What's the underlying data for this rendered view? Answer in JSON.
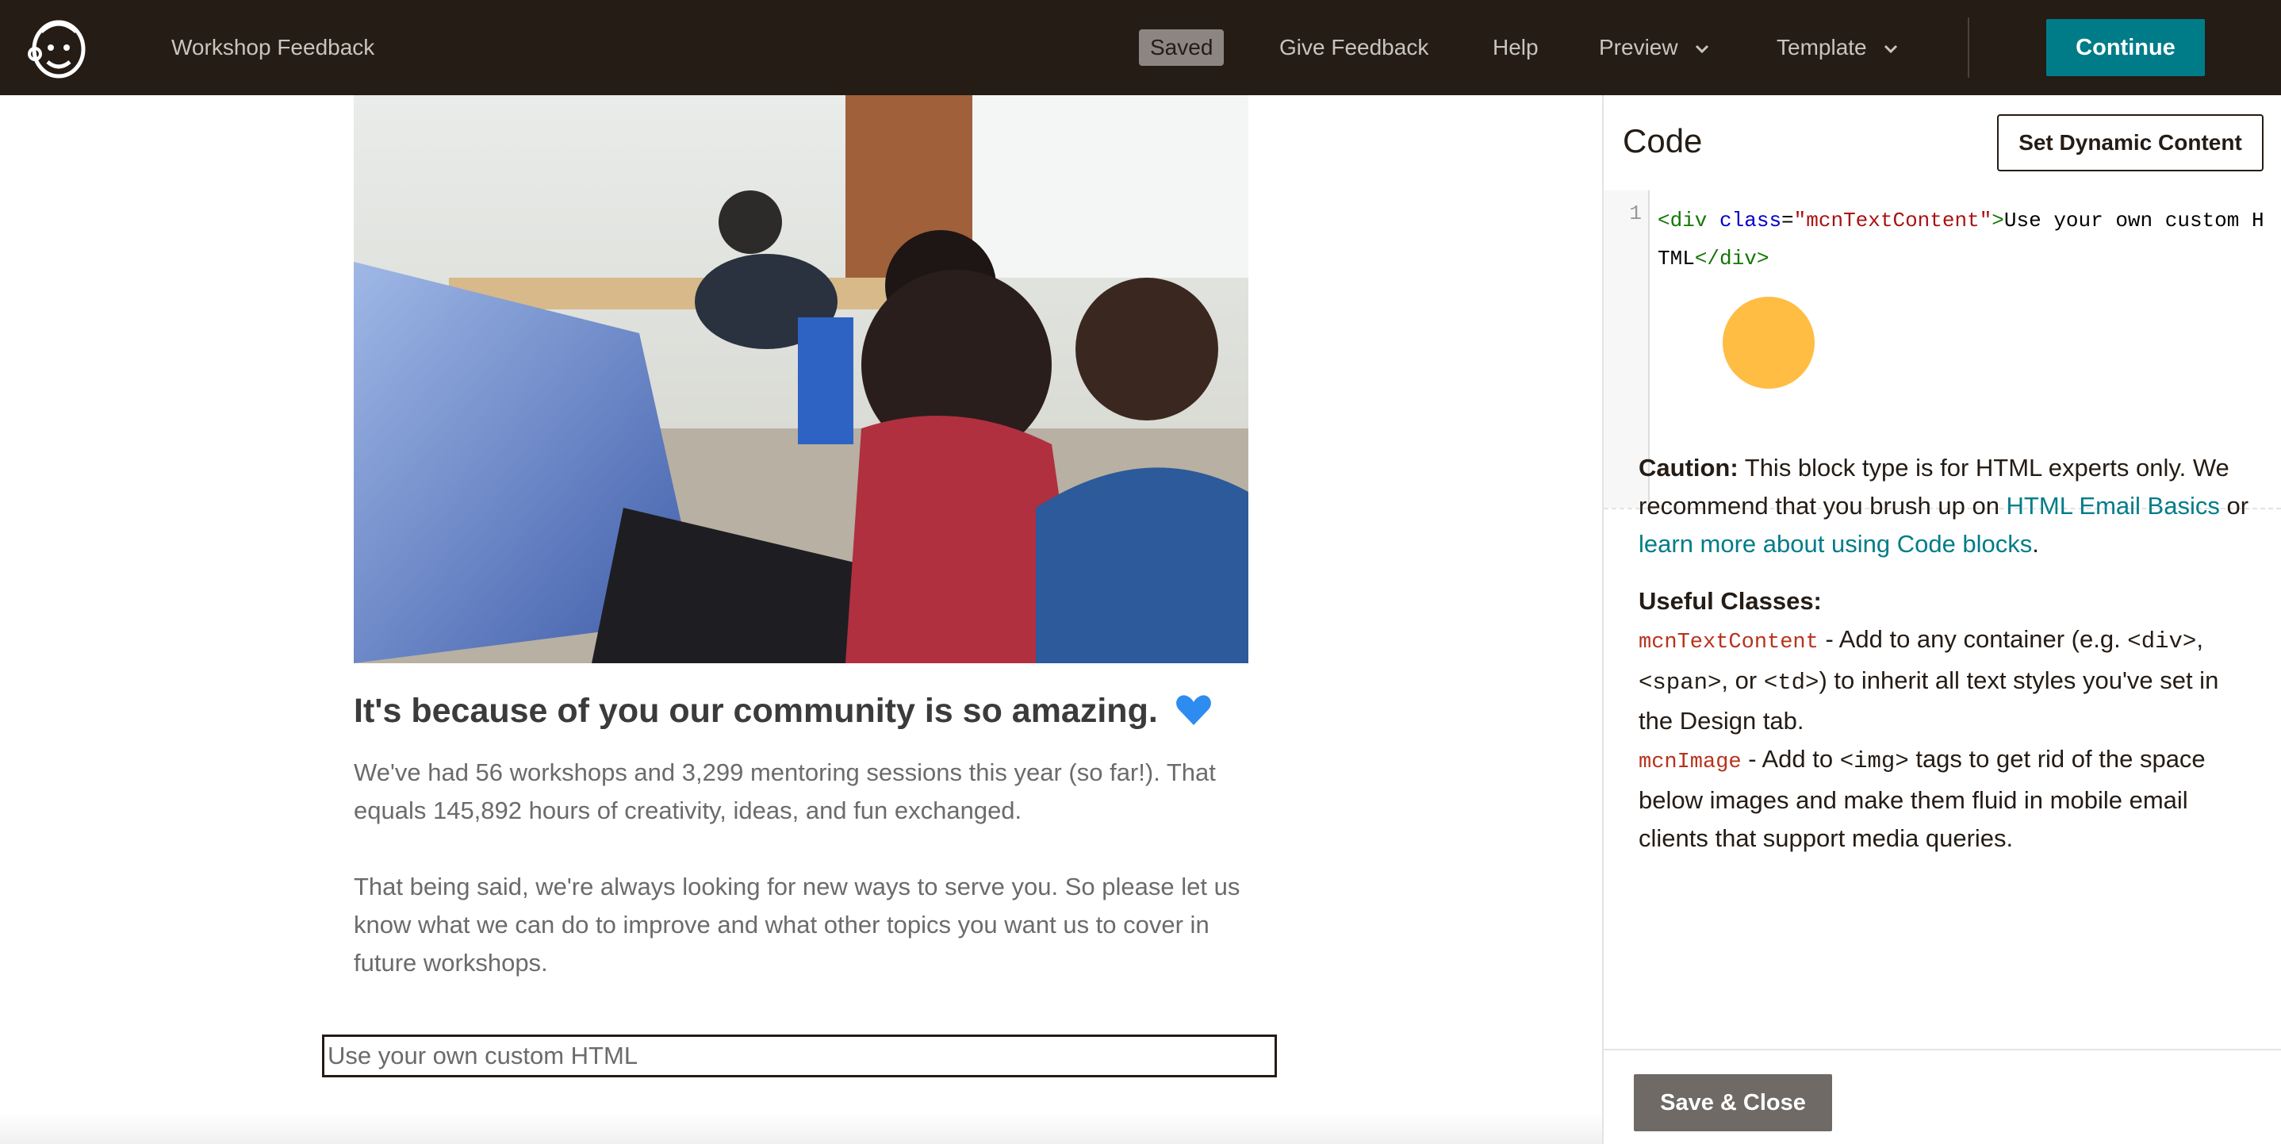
{
  "topbar": {
    "campaign_name": "Workshop Feedback",
    "saved_badge": "Saved",
    "nav": {
      "give_feedback": "Give Feedback",
      "help": "Help",
      "preview": "Preview",
      "template": "Template"
    },
    "continue_label": "Continue"
  },
  "email": {
    "heading": "It's because of you our community is so amazing.",
    "heading_emoji": "blue-heart-icon",
    "paragraph_1": "We've had 56 workshops and 3,299 mentoring sessions this year (so far!). That equals 145,892 hours of creativity, ideas, and fun exchanged.",
    "paragraph_2": "That being said, we're always looking for new ways to serve you. So please let us know what we can do to improve and what other topics you want us to cover in future workshops.",
    "custom_block_text": "Use your own custom HTML"
  },
  "panel": {
    "title": "Code",
    "dynamic_button": "Set Dynamic Content",
    "editor": {
      "line_number": "1",
      "tokens": {
        "open_tag": "<div",
        "attr_name": "class",
        "equals": "=",
        "attr_value": "\"mcnTextContent\"",
        "close_bracket": ">",
        "text": "Use your own custom HTML",
        "end_tag": "</div>"
      }
    },
    "caution": {
      "label": "Caution:",
      "text_1": " This block type is for HTML experts only. We recommend that you brush up on ",
      "link_1": "HTML Email Basics",
      "text_2": " or ",
      "link_2": "learn more about using Code blocks",
      "text_3": "."
    },
    "useful_classes": {
      "label": "Useful Classes:",
      "class_1_name": "mcnTextContent",
      "class_1_desc_1": " - Add to any container (e.g. ",
      "class_1_code_1": "<div>",
      "class_1_desc_2": ", ",
      "class_1_code_2": "<span>",
      "class_1_desc_3": ", or ",
      "class_1_code_3": "<td>",
      "class_1_desc_4": ") to inherit all text styles you've set in the Design tab.",
      "class_2_name": "mcnImage",
      "class_2_desc_1": " - Add to ",
      "class_2_code_1": "<img>",
      "class_2_desc_2": " tags to get rid of the space below images and make them fluid in mobile email clients that support media queries."
    },
    "save_close": "Save & Close"
  },
  "colors": {
    "topbar_bg": "#241c15",
    "accent_teal": "#007c89",
    "save_button": "#6f6a66",
    "cursor_highlight": "#ffac14"
  }
}
